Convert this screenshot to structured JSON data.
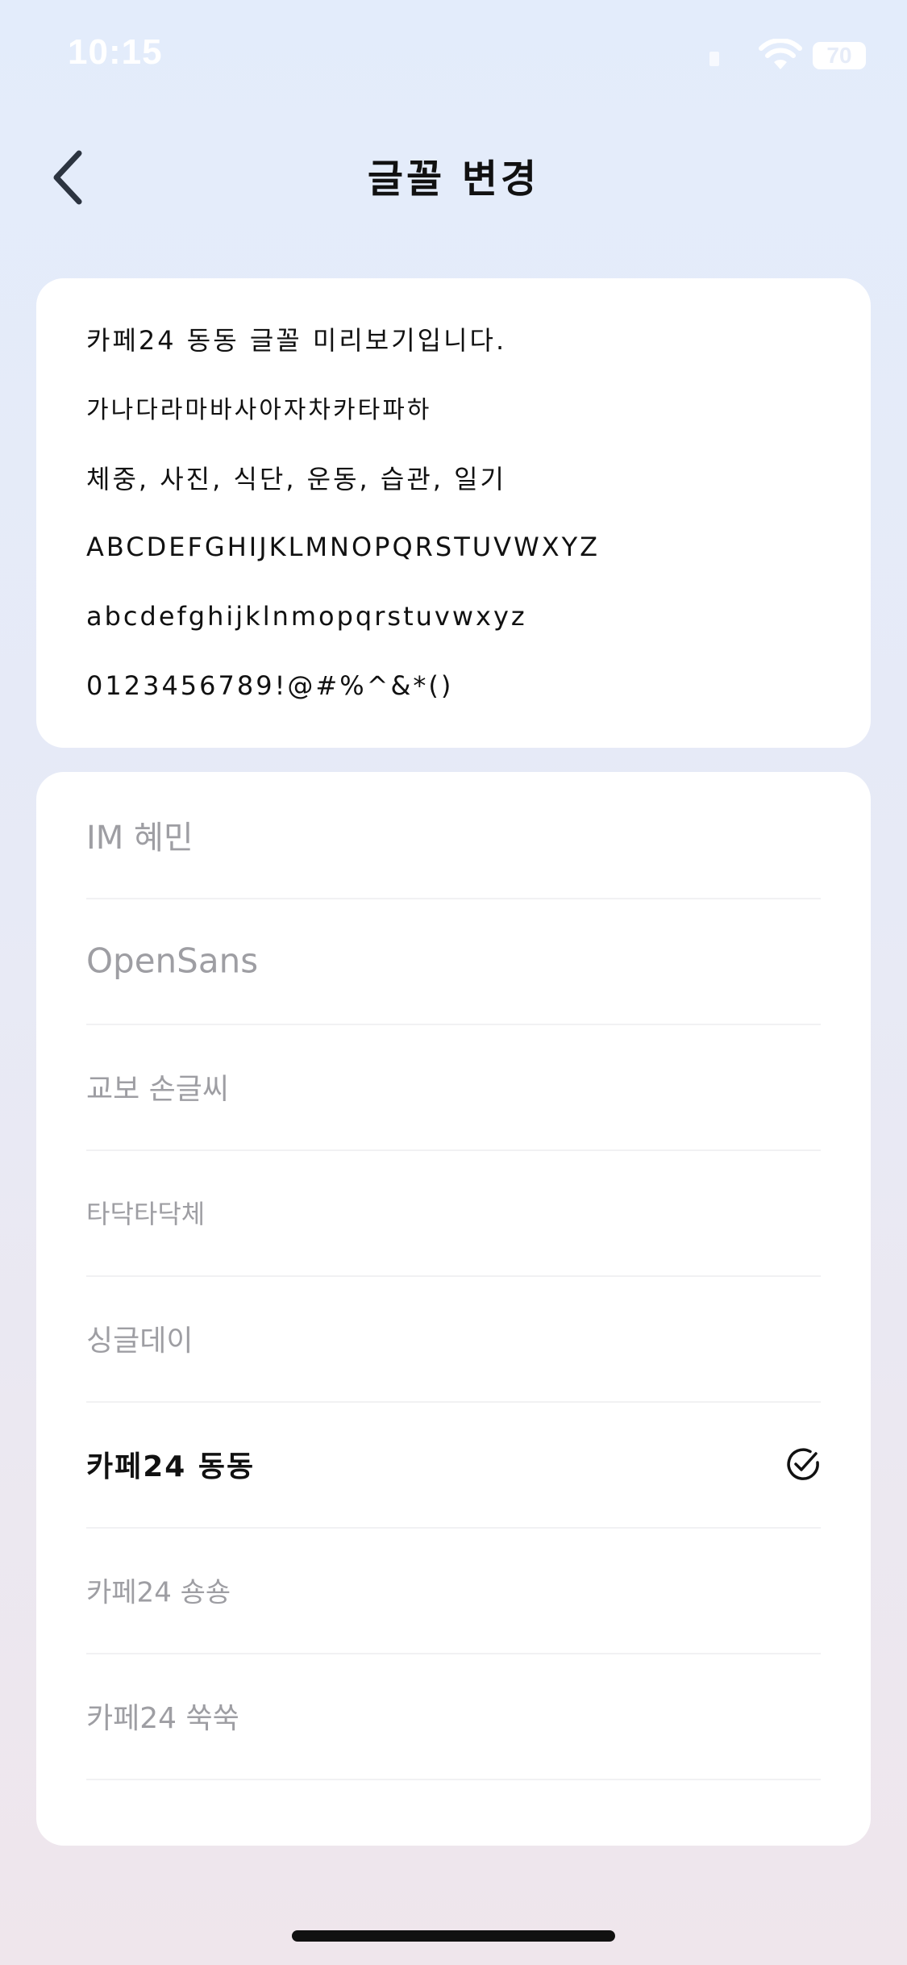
{
  "status_bar": {
    "time": "10:15",
    "battery": "70"
  },
  "header": {
    "title": "글꼴 변경",
    "back_icon": "chevron-left-icon"
  },
  "preview": {
    "lines": [
      "카페24 동동 글꼴 미리보기입니다.",
      "가나다라마바사아자차카타파하",
      "체중, 사진, 식단, 운동, 습관, 일기",
      "ABCDEFGHIJKLMNOPQRSTUVWXYZ",
      "abcdefghijklnmopqrstuvwxyz",
      "0123456789!@#%^&*()"
    ]
  },
  "fonts": {
    "items": [
      {
        "label": "IM 혜민",
        "selected": false
      },
      {
        "label": "OpenSans",
        "selected": false
      },
      {
        "label": "교보 손글씨",
        "selected": false
      },
      {
        "label": "타닥타닥체",
        "selected": false
      },
      {
        "label": "싱글데이",
        "selected": false
      },
      {
        "label": "카페24 동동",
        "selected": true
      },
      {
        "label": "카페24 숑숑",
        "selected": false
      },
      {
        "label": "카페24 쑥쑥",
        "selected": false
      }
    ],
    "selected_icon": "check-circle-icon"
  },
  "colors": {
    "selected_text": "#111111",
    "unselected_text": "#9e9ea3",
    "card": "#ffffff"
  }
}
